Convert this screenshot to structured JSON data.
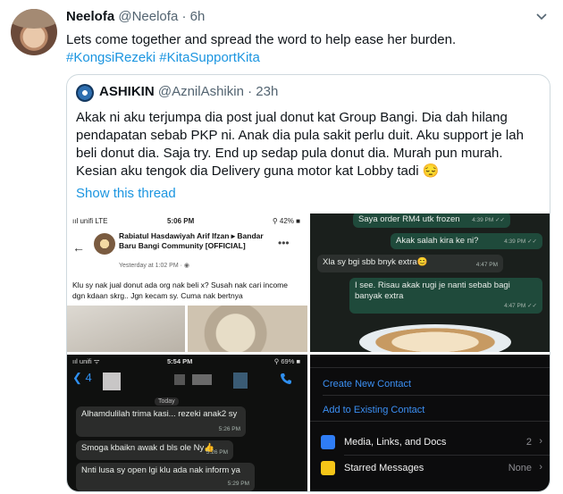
{
  "tweet": {
    "name": "Neelofa",
    "handle": "@Neelofa",
    "separator": "·",
    "time": "6h",
    "text": "Lets come together and spread the word to help ease her burden.",
    "hashtags": [
      "#KongsiRezeki",
      "#KitaSupportKita"
    ]
  },
  "quoted": {
    "name": "ASHIKIN",
    "handle": "@AznilAshikin",
    "separator": "·",
    "time": "23h",
    "text": "Akak ni aku terjumpa dia post jual donut kat Group Bangi. Dia dah hilang pendapatan sebab PKP ni. Anak dia pula sakit perlu duit. Aku support je lah beli donut dia. Saja try. End up sedap pula donut dia. Murah pun murah. Kesian aku tengok dia Delivery guna motor kat Lobby tadi 😔",
    "show_thread": "Show this thread"
  },
  "screens": {
    "fb": {
      "carrier": "ııl unifi  LTE",
      "time": "5:06 PM",
      "battery": "⚲ 42% ■",
      "poster": "Rabiatul Hasdawiyah Arif Ifzan ▸ Bandar Baru Bangi Community [OFFICIAL]",
      "posted_at": "Yesterday at 1:02 PM · ◉",
      "more": "•••",
      "post": "Klu sy nak jual donut ada org nak beli x? Susah nak cari income dgn kdaan skrg.. Jgn kecam sy. Cuma nak bertnya"
    },
    "chat1": [
      {
        "text": "Saya order RM4 utk frozen",
        "time": "4:39 PM ✓✓"
      },
      {
        "text": "Akak salah kira ke ni?",
        "time": "4:39 PM ✓✓"
      },
      {
        "text": "Xla sy bgi sbb bnyk extra😊",
        "time": "4:47 PM"
      },
      {
        "text": "I see. Risau akak rugi je nanti sebab bagi banyak extra",
        "time": "4:47 PM ✓✓"
      }
    ],
    "chat2": {
      "carrier": "ııl unifi  ᯤ",
      "time": "5:54 PM",
      "battery": "⚲ 69% ■",
      "back": "❮ 4",
      "today": "Today",
      "messages": [
        {
          "text": "Alhamdulilah trima kasi... rezeki anak2 sy",
          "time": "5:26 PM"
        },
        {
          "text": "Smoga kbaikn awak d bls ole Ny👍",
          "time": "5:26 PM"
        },
        {
          "text": "Nnti lusa sy open lgi klu ada nak inform ya",
          "time": "5:29 PM"
        }
      ]
    },
    "contact": {
      "create": "Create New Contact",
      "add": "Add to Existing Contact",
      "media_label": "Media, Links, and Docs",
      "media_value": "2",
      "starred_label": "Starred Messages",
      "starred_value": "None",
      "arrow": "›"
    }
  }
}
